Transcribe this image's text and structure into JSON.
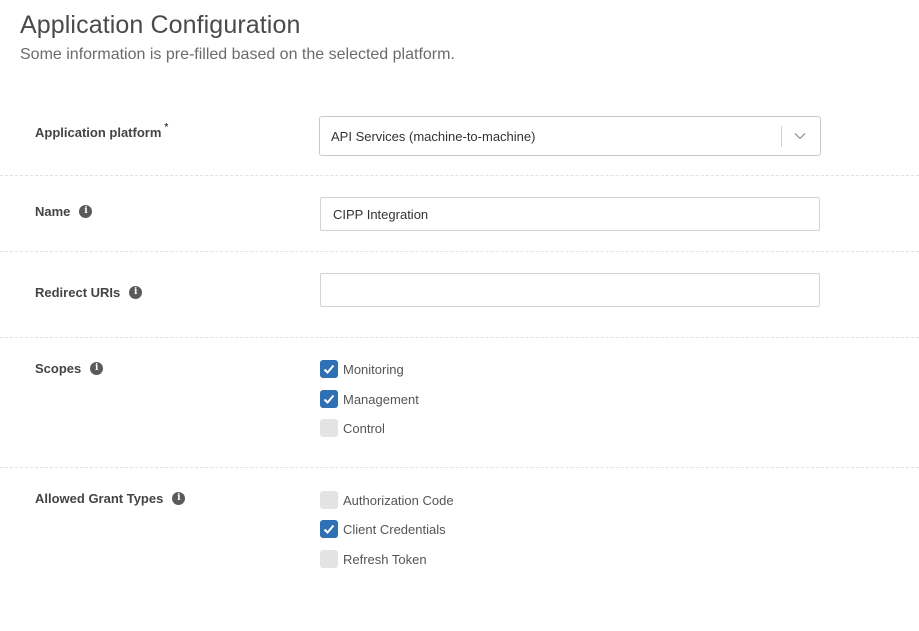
{
  "header": {
    "title": "Application Configuration",
    "subtitle": "Some information is pre-filled based on the selected platform."
  },
  "fields": {
    "platform": {
      "label": "Application platform",
      "required_mark": "*",
      "value": "API Services (machine-to-machine)"
    },
    "name": {
      "label": "Name",
      "value": "CIPP Integration"
    },
    "redirect_uris": {
      "label": "Redirect URIs",
      "value": ""
    },
    "scopes": {
      "label": "Scopes",
      "options": [
        {
          "label": "Monitoring",
          "checked": true
        },
        {
          "label": "Management",
          "checked": true
        },
        {
          "label": "Control",
          "checked": false
        }
      ]
    },
    "grant_types": {
      "label": "Allowed Grant Types",
      "options": [
        {
          "label": "Authorization Code",
          "checked": false
        },
        {
          "label": "Client Credentials",
          "checked": true
        },
        {
          "label": "Refresh Token",
          "checked": false
        }
      ]
    }
  },
  "icons": {
    "info": "info-icon",
    "chevron": "chevron-down-icon",
    "check": "checkmark-icon"
  },
  "colors": {
    "checkbox_checked": "#2f6fb4",
    "checkbox_unchecked": "#e3e3e3"
  }
}
